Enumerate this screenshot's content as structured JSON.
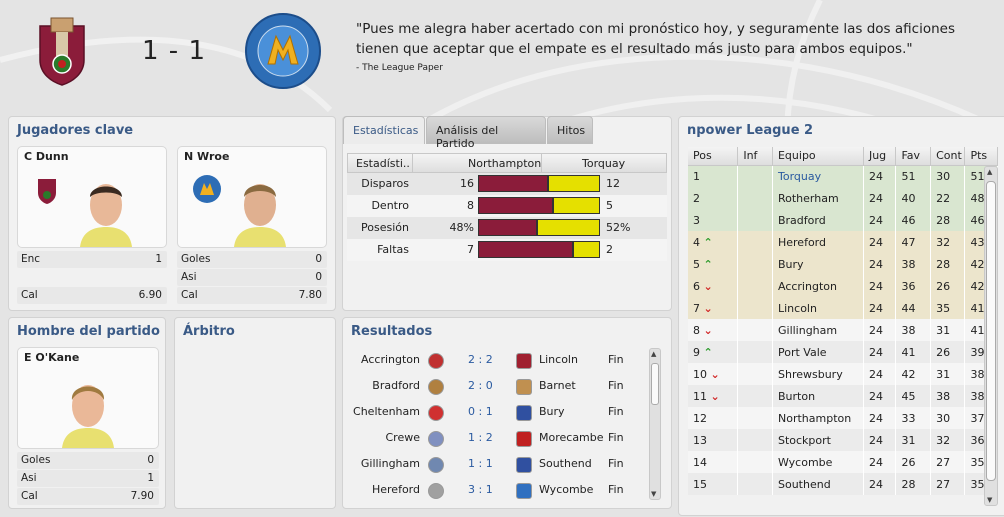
{
  "header": {
    "score": "1 - 1",
    "quote": "\"Pues me alegra haber acertado con mi pronóstico hoy, y seguramente las dos aficiones tienen que aceptar que el empate es el resultado más justo para ambos equipos.\"",
    "source": "- The League Paper"
  },
  "key_players": {
    "title": "Jugadores clave",
    "players": [
      {
        "name": "C Dunn",
        "stats": [
          {
            "label": "Enc",
            "value": "1"
          },
          {
            "label": "Cal",
            "value": "6.90"
          }
        ]
      },
      {
        "name": "N Wroe",
        "stats": [
          {
            "label": "Goles",
            "value": "0"
          },
          {
            "label": "Asi",
            "value": "0"
          },
          {
            "label": "Cal",
            "value": "7.80"
          }
        ]
      }
    ]
  },
  "motm": {
    "title": "Hombre del partido",
    "name": "E O'Kane",
    "stats": [
      {
        "label": "Goles",
        "value": "0"
      },
      {
        "label": "Asi",
        "value": "1"
      },
      {
        "label": "Cal",
        "value": "7.90"
      }
    ]
  },
  "referee": {
    "title": "Árbitro"
  },
  "tabs": [
    "Estadísticas",
    "Análisis del Partido",
    "Hitos"
  ],
  "stats": {
    "header": {
      "col": "Estadísti..",
      "home": "Northampton",
      "away": "Torquay"
    },
    "rows": [
      {
        "label": "Disparos",
        "home": "16",
        "away": "12",
        "home_frac": 0.571
      },
      {
        "label": "Dentro",
        "home": "8",
        "away": "5",
        "home_frac": 0.615
      },
      {
        "label": "Posesión",
        "home": "48%",
        "away": "52%",
        "home_frac": 0.48
      },
      {
        "label": "Faltas",
        "home": "7",
        "away": "2",
        "home_frac": 0.778
      }
    ],
    "colors": {
      "home": "#8b1c3a",
      "away": "#e5e000"
    }
  },
  "results": {
    "title": "Resultados",
    "rows": [
      {
        "home": "Accrington",
        "score": "2 : 2",
        "away": "Lincoln",
        "status": "Fin"
      },
      {
        "home": "Bradford",
        "score": "2 : 0",
        "away": "Barnet",
        "status": "Fin"
      },
      {
        "home": "Cheltenham",
        "score": "0 : 1",
        "away": "Bury",
        "status": "Fin"
      },
      {
        "home": "Crewe",
        "score": "1 : 2",
        "away": "Morecambe",
        "status": "Fin"
      },
      {
        "home": "Gillingham",
        "score": "1 : 1",
        "away": "Southend",
        "status": "Fin"
      },
      {
        "home": "Hereford",
        "score": "3 : 1",
        "away": "Wycombe",
        "status": "Fin"
      }
    ]
  },
  "league": {
    "title": "npower League 2",
    "columns": [
      "Pos",
      "Inf",
      "Equipo",
      "Jug",
      "Fav",
      "Cont",
      "Pts"
    ],
    "rows": [
      {
        "pos": "1",
        "inf": "",
        "team": "Torquay",
        "jug": "24",
        "fav": "51",
        "cont": "30",
        "pts": "51"
      },
      {
        "pos": "2",
        "inf": "",
        "team": "Rotherham",
        "jug": "24",
        "fav": "40",
        "cont": "22",
        "pts": "48"
      },
      {
        "pos": "3",
        "inf": "",
        "team": "Bradford",
        "jug": "24",
        "fav": "46",
        "cont": "28",
        "pts": "46"
      },
      {
        "pos": "4",
        "inf": "up",
        "team": "Hereford",
        "jug": "24",
        "fav": "47",
        "cont": "32",
        "pts": "43"
      },
      {
        "pos": "5",
        "inf": "up",
        "team": "Bury",
        "jug": "24",
        "fav": "38",
        "cont": "28",
        "pts": "42"
      },
      {
        "pos": "6",
        "inf": "down",
        "team": "Accrington",
        "jug": "24",
        "fav": "36",
        "cont": "26",
        "pts": "42"
      },
      {
        "pos": "7",
        "inf": "down",
        "team": "Lincoln",
        "jug": "24",
        "fav": "44",
        "cont": "35",
        "pts": "41"
      },
      {
        "pos": "8",
        "inf": "down",
        "team": "Gillingham",
        "jug": "24",
        "fav": "38",
        "cont": "31",
        "pts": "41"
      },
      {
        "pos": "9",
        "inf": "up",
        "team": "Port Vale",
        "jug": "24",
        "fav": "41",
        "cont": "26",
        "pts": "39"
      },
      {
        "pos": "10",
        "inf": "down",
        "team": "Shrewsbury",
        "jug": "24",
        "fav": "42",
        "cont": "31",
        "pts": "38"
      },
      {
        "pos": "11",
        "inf": "down",
        "team": "Burton",
        "jug": "24",
        "fav": "45",
        "cont": "38",
        "pts": "38"
      },
      {
        "pos": "12",
        "inf": "",
        "team": "Northampton",
        "jug": "24",
        "fav": "33",
        "cont": "30",
        "pts": "37"
      },
      {
        "pos": "13",
        "inf": "",
        "team": "Stockport",
        "jug": "24",
        "fav": "31",
        "cont": "32",
        "pts": "36"
      },
      {
        "pos": "14",
        "inf": "",
        "team": "Wycombe",
        "jug": "24",
        "fav": "26",
        "cont": "27",
        "pts": "35"
      },
      {
        "pos": "15",
        "inf": "",
        "team": "Southend",
        "jug": "24",
        "fav": "28",
        "cont": "27",
        "pts": "35"
      }
    ]
  }
}
